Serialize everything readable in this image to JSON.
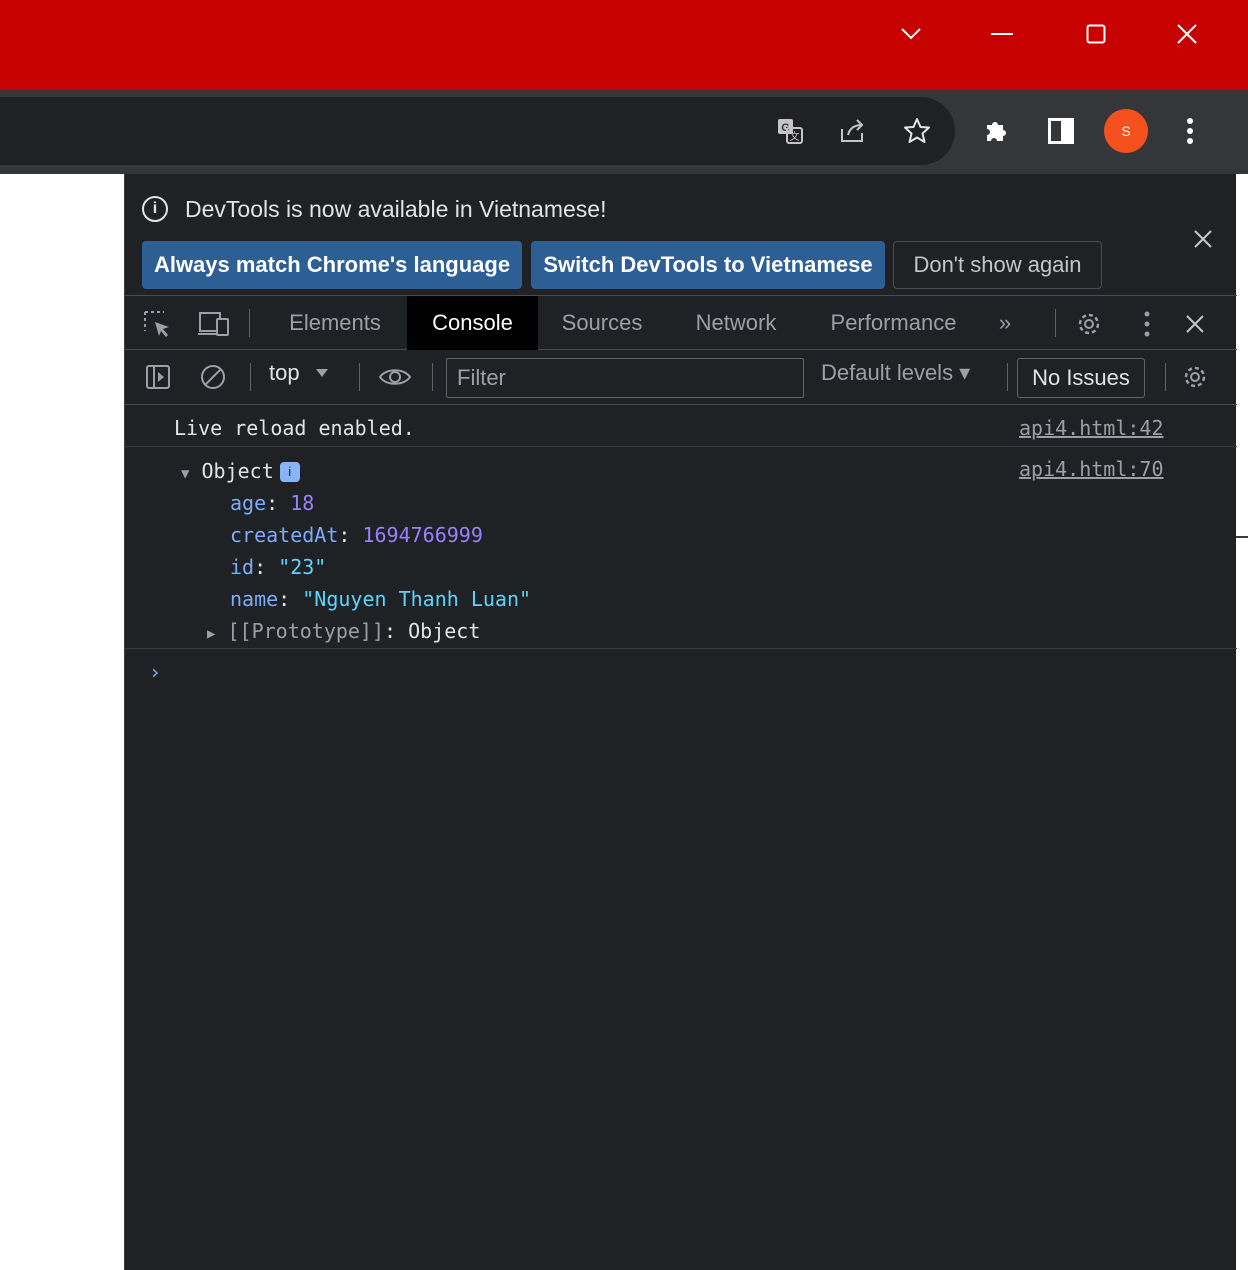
{
  "colors": {
    "title_bar": "#c70000",
    "toolbar": "#35363a",
    "omnibox": "#202124",
    "devtools_bg": "#202124",
    "primary_button": "#2d5f95",
    "avatar": "#f4511e",
    "property_key": "#7cacf8",
    "number_value": "#9980ff",
    "string_value": "#5cd5fb"
  },
  "browser": {
    "window_controls": {
      "tab_search_icon": "chevron-down-icon",
      "minimize_icon": "minimize-icon",
      "maximize_icon": "maximize-icon",
      "close_icon": "close-icon"
    },
    "toolbar": {
      "icons": [
        "translate-icon",
        "share-icon",
        "star-icon",
        "extensions-icon",
        "side-panel-icon",
        "more-vert-icon"
      ],
      "avatar_letter": "S"
    }
  },
  "devtools": {
    "infobar": {
      "message": "DevTools is now available in Vietnamese!",
      "buttons": {
        "always_match": "Always match Chrome's language",
        "switch": "Switch DevTools to Vietnamese",
        "dont_show": "Don't show again"
      }
    },
    "tabs": [
      "Elements",
      "Console",
      "Sources",
      "Network",
      "Performance"
    ],
    "more_tabs": "»",
    "console_toolbar": {
      "context": "top",
      "filter_placeholder": "Filter",
      "levels": "Default levels ▾",
      "issues": "No Issues"
    },
    "messages": [
      {
        "text": "Live reload enabled.",
        "source": "api4.html:42"
      },
      {
        "label": "Object",
        "source": "api4.html:70",
        "properties": [
          {
            "key": "age",
            "value": "18",
            "kind": "number"
          },
          {
            "key": "createdAt",
            "value": "1694766999",
            "kind": "number"
          },
          {
            "key": "id",
            "value": "\"23\"",
            "kind": "string"
          },
          {
            "key": "name",
            "value": "\"Nguyen Thanh Luan\"",
            "kind": "string"
          }
        ],
        "prototype_key": "[[Prototype]]",
        "prototype_value": "Object"
      }
    ],
    "prompt": "›"
  }
}
